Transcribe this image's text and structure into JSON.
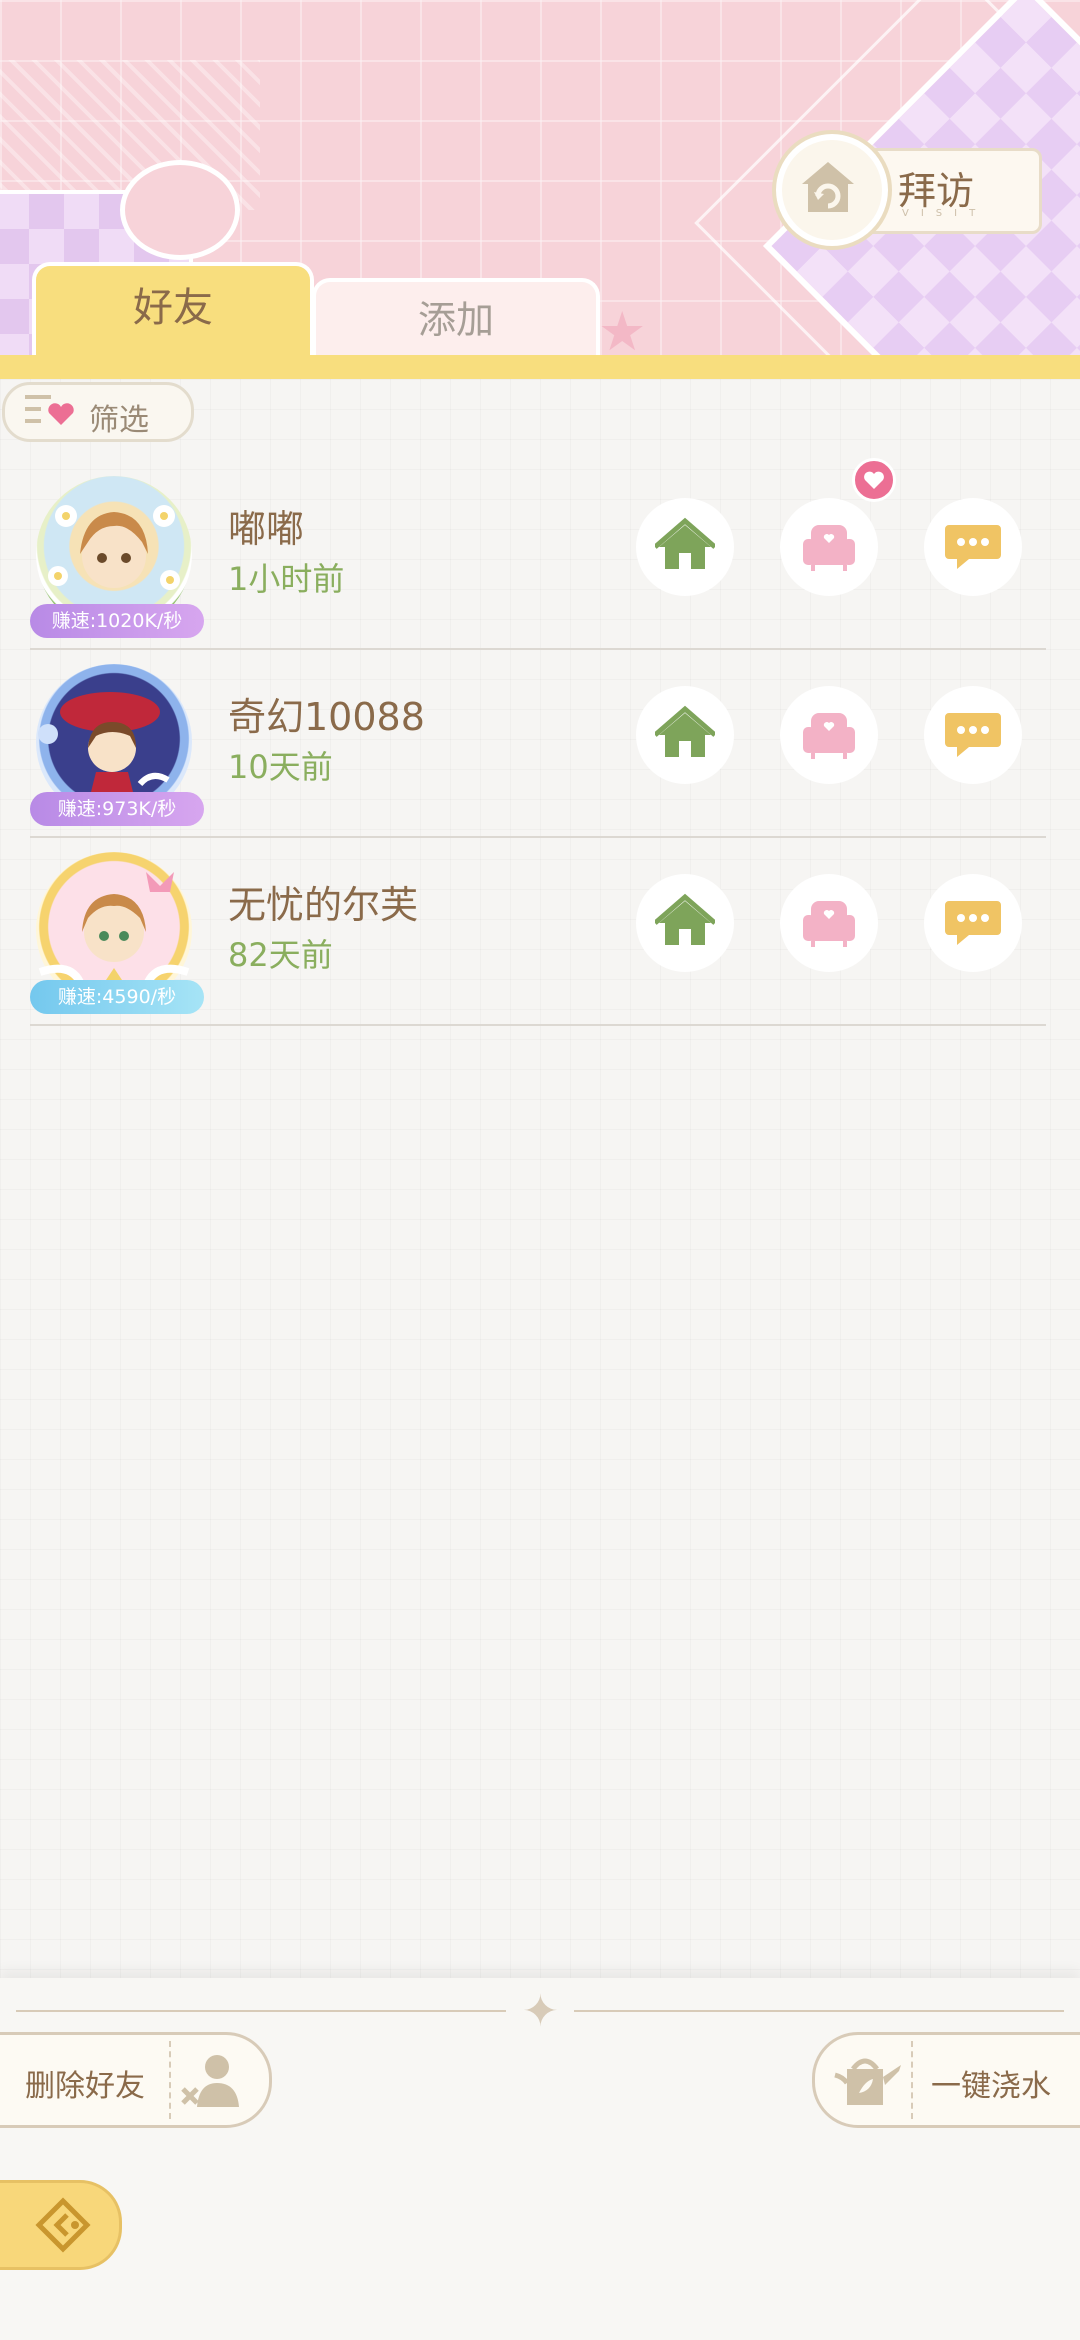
{
  "header": {
    "visit_label": "拜访",
    "visit_sub": "VISIT"
  },
  "tabs": [
    {
      "label": "好友",
      "active": true
    },
    {
      "label": "添加",
      "active": false
    }
  ],
  "filter": {
    "label": "筛选"
  },
  "friends": [
    {
      "name": "嘟嘟",
      "time": "1小时前",
      "speed": "赚速:1020K/秒",
      "has_heart_badge": true
    },
    {
      "name": "奇幻10088",
      "time": "10天前",
      "speed": "赚速:973K/秒",
      "has_heart_badge": false
    },
    {
      "name": "无忧的尔芙",
      "time": "82天前",
      "speed": "赚速:4590/秒",
      "has_heart_badge": false
    }
  ],
  "bottom": {
    "delete_label": "删除好友",
    "water_label": "一键浇水"
  },
  "colors": {
    "accent_yellow": "#f8de7e",
    "header_pink": "#f7d3d9",
    "house_green": "#7ea45a",
    "sofa_pink": "#f3b2c6",
    "chat_yellow": "#f0c464",
    "text_brown": "#8a6a4a",
    "time_green": "#8aae5e"
  }
}
